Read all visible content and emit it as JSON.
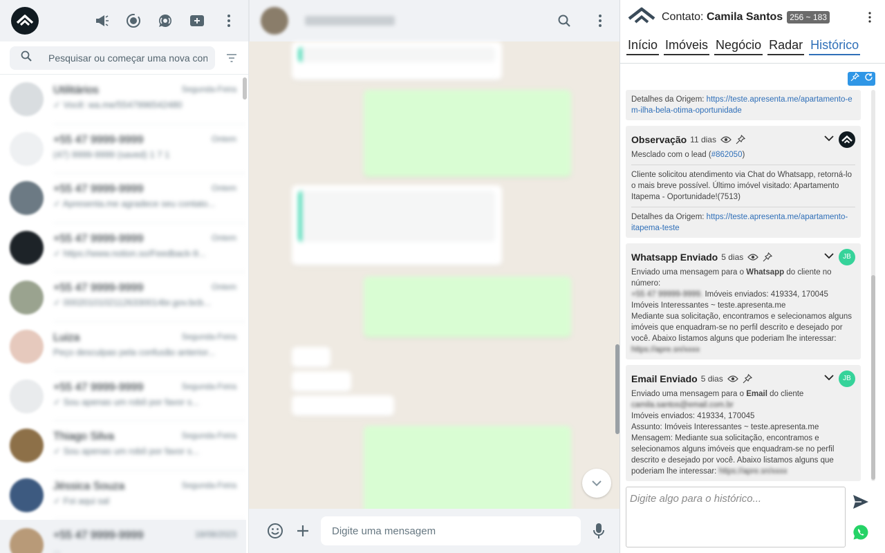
{
  "left": {
    "search_placeholder": "Pesquisar ou começar uma nova conversa",
    "header_icons": [
      "megaphone-icon",
      "status-icon",
      "channels-icon",
      "new-chat-icon",
      "menu-icon"
    ],
    "chats": [
      {
        "name": "Utilitários",
        "time": "Segunda-Feira",
        "preview": "✓ Você: wa.me/5547996542480",
        "avatar": "#d9dde0"
      },
      {
        "name": "+55 47 9999-9999",
        "time": "Ontem",
        "preview": "(47) 9999-9999 (saved) 1 7 1",
        "avatar": "#eef0f2"
      },
      {
        "name": "+55 47 9999-9999",
        "time": "Ontem",
        "preview": "✓ Apresenta.me agradece seu contato...",
        "avatar": "#6c7a84"
      },
      {
        "name": "+55 47 9999-9999",
        "time": "Ontem",
        "preview": "✓ https://www.notion.so/Feedback-9...",
        "avatar": "#1d2328"
      },
      {
        "name": "+55 47 9999-9999",
        "time": "Ontem",
        "preview": "✓ 00020101021126330014br.gov.bcb...",
        "avatar": "#9aa38f"
      },
      {
        "name": "Luiza",
        "time": "Segunda-Feira",
        "preview": "Peço desculpas pela confusão anterior...",
        "avatar": "#e6c9bd"
      },
      {
        "name": "+55 47 9999-9999",
        "time": "Segunda-Feira",
        "preview": "✓ Sou apenas um robô por favor s...",
        "avatar": "#e9ebed"
      },
      {
        "name": "Thiago Silva",
        "time": "Segunda-Feira",
        "preview": "✓ Sou apenas um robô por favor s...",
        "avatar": "#8d7048"
      },
      {
        "name": "Jéssica Souza",
        "time": "Segunda-Feira",
        "preview": "✓ Foi aqui sal",
        "avatar": "#3d5a80"
      },
      {
        "name": "+55 47 9999-9999",
        "time": "18/08/2023",
        "preview": "...",
        "avatar": "#b89a78"
      }
    ]
  },
  "middle": {
    "input_placeholder": "Digite uma mensagem"
  },
  "right": {
    "contact_prefix": "Contato:",
    "contact_name": "Camila Santos",
    "contact_badge": "256 ~ 183",
    "tabs": [
      "Início",
      "Imóveis",
      "Negócio",
      "Radar",
      "Histórico"
    ],
    "active_tab": "Histórico",
    "card0": {
      "origin_label": "Detalhes da Origem:",
      "origin_link": "https://teste.apresenta.me/apartamento-em-ilha-bela-otima-oportunidade"
    },
    "card1": {
      "title": "Observação",
      "age": "11 dias",
      "merged_prefix": "Mesclado com o lead (",
      "merged_link": "#862050",
      "merged_suffix": ")",
      "body": "Cliente solicitou atendimento via Chat do Whatsapp, retorná-lo o mais breve possível. Último imóvel visitado: Apartamento Itapema - Oportunidade!(7513)",
      "origin_label": "Detalhes da Origem:",
      "origin_link": "https://teste.apresenta.me/apartamento-itapema-teste"
    },
    "card2": {
      "title": "Whatsapp Enviado",
      "age": "5 dias",
      "badge": "JB",
      "l1_prefix": "Enviado uma mensagem para o ",
      "l1_bold": "Whatsapp",
      "l1_suffix": " do cliente no número:",
      "l2_hidden": "+55 47 99999-9999.",
      "l2": " Imóveis enviados: 419334, 170045",
      "l3": "Imóveis Interessantes ~ teste.apresenta.me",
      "l4": "Mediante sua solicitação, encontramos e selecionamos alguns imóveis que enquadram-se no perfil descrito e desejado por você. Abaixo listamos alguns que poderiam lhe interessar:",
      "l4_hidden": "https://apre.sn/xxxx"
    },
    "card3": {
      "title": "Email Enviado",
      "age": "5 dias",
      "badge": "JB",
      "l1_prefix": "Enviado uma mensagem para o ",
      "l1_bold": "Email",
      "l1_suffix": " do cliente",
      "l2_hidden": "camila.santos@email.com.br",
      "l3": "Imóveis enviados: 419334, 170045",
      "l4": "Assunto: Imóveis Interessantes ~ teste.apresenta.me",
      "l5": "Mensagem: Mediante sua solicitação, encontramos e selecionamos alguns imóveis que enquadram-se no perfil descrito e desejado por você. Abaixo listamos alguns que poderiam lhe interessar:",
      "l5_hidden": "https://apre.sn/xxxx"
    },
    "history_placeholder": "Digite algo para o histórico..."
  },
  "colors": {
    "accent_blue": "#2f6fb8",
    "whatsapp_green": "#25d366",
    "badge_green": "#36d39a"
  }
}
